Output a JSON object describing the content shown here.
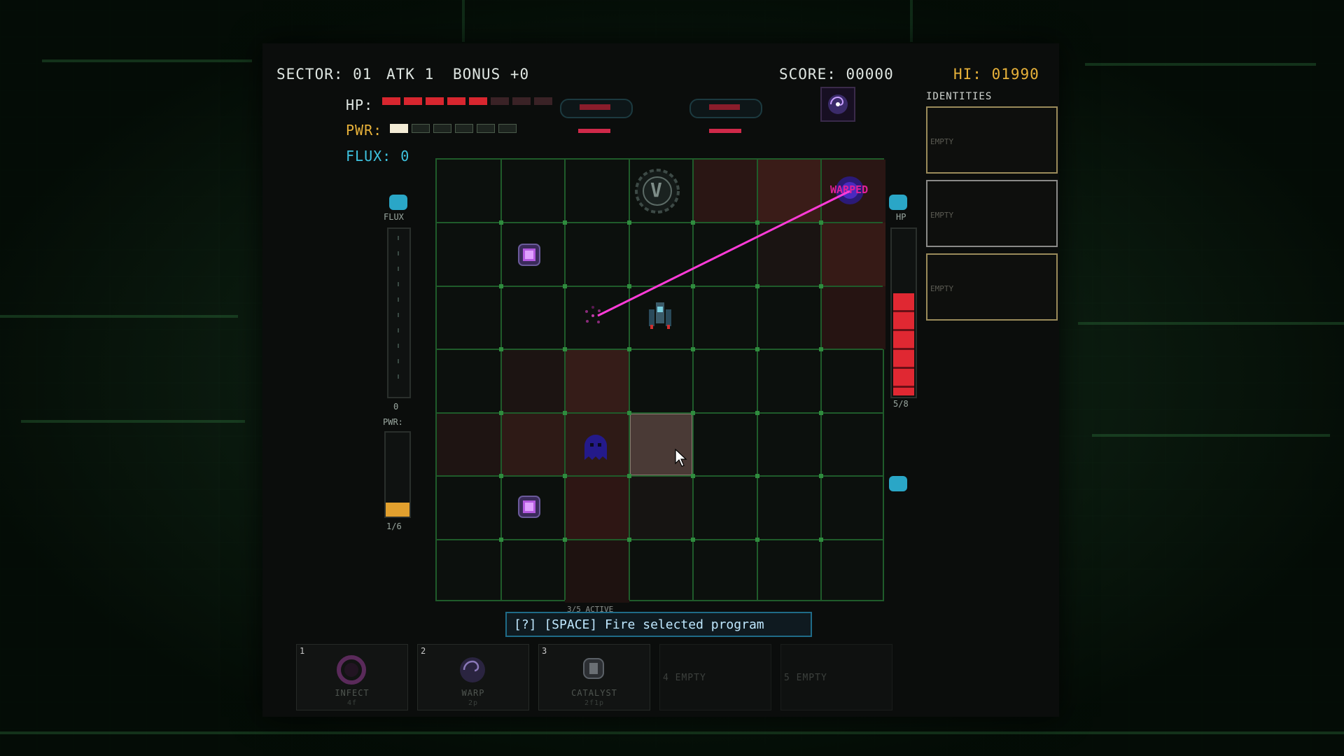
{
  "hud": {
    "sector": "SECTOR: 01",
    "atk": "ATK 1",
    "bonus": "BONUS +0",
    "score": "SCORE: 00000",
    "hi": "HI: 01990",
    "hp_label": "HP:",
    "pwr_label": "PWR:",
    "flux_label": "FLUX: 0"
  },
  "hp_bar": {
    "filled": 5,
    "total": 8,
    "color": "#d8262f"
  },
  "pwr_bar": {
    "filled": 1,
    "total": 6
  },
  "left_meters": {
    "flux_title": "FLUX",
    "flux_value": "0",
    "pwr_title": "PWR:",
    "pwr_value": "1/6"
  },
  "right_meter": {
    "title": "HP",
    "value": "5/8",
    "filled": 5,
    "total": 8
  },
  "identities": {
    "title": "IDENTITIES",
    "slots": [
      "EMPTY",
      "EMPTY",
      "EMPTY"
    ]
  },
  "board": {
    "enemy_label": "WARPED",
    "active_label": "3/5 ACTIVE",
    "marker_letter": "V"
  },
  "hint": "[?] [SPACE] Fire selected program",
  "programs": [
    {
      "num": "1",
      "name": "INFECT",
      "cost": "4f"
    },
    {
      "num": "2",
      "name": "WARP",
      "cost": "2p"
    },
    {
      "num": "3",
      "name": "CATALYST",
      "cost": "2f1p"
    },
    {
      "num": "",
      "name": "4 EMPTY",
      "cost": ""
    },
    {
      "num": "",
      "name": "5 EMPTY",
      "cost": ""
    }
  ],
  "colors": {
    "accent_gold": "#e8b23a",
    "flux_cyan": "#3ec3e0",
    "laser": "#ff3bd8",
    "hp_red": "#d8262f"
  }
}
